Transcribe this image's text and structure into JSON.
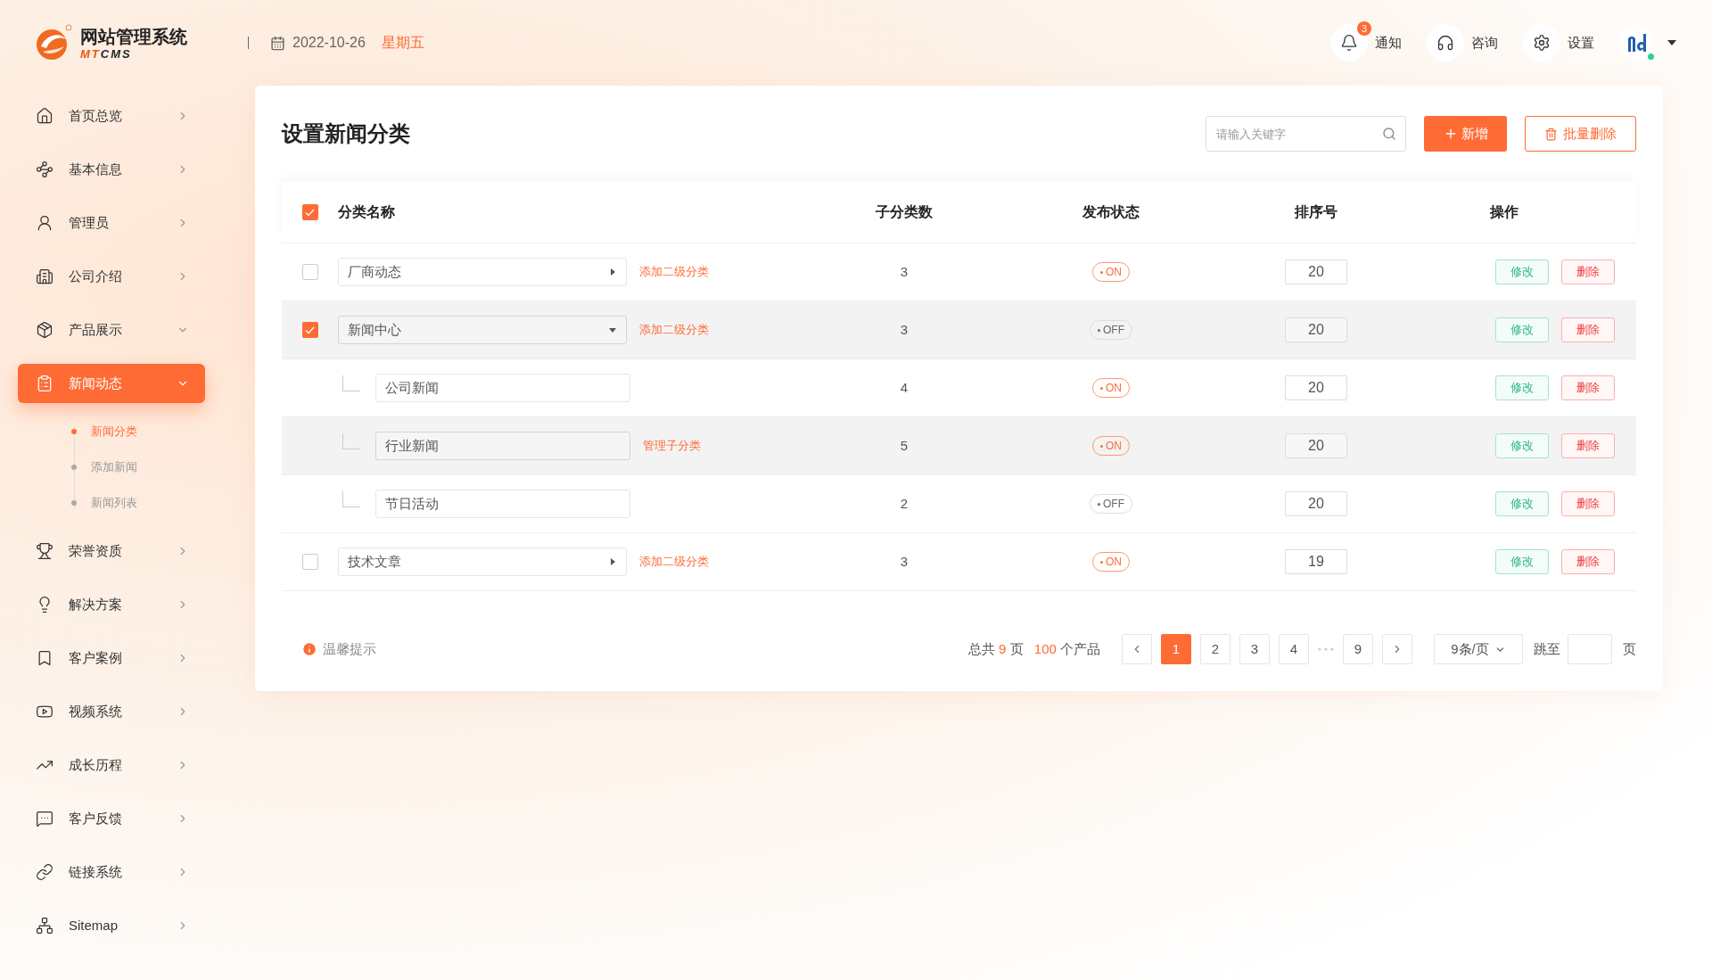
{
  "logo": {
    "title": "网站管理系统",
    "subtitle_parts": [
      "MT",
      "CMS"
    ]
  },
  "header": {
    "date": "2022-10-26",
    "weekday": "星期五",
    "notify": {
      "label": "通知",
      "badge": "3"
    },
    "consult": {
      "label": "咨询"
    },
    "settings": {
      "label": "设置"
    },
    "avatar": {
      "online": true
    }
  },
  "sidebar": {
    "items": [
      {
        "label": "首页总览",
        "selected": false,
        "expanded": false
      },
      {
        "label": "基本信息",
        "selected": false,
        "expanded": false
      },
      {
        "label": "管理员",
        "selected": false,
        "expanded": false
      },
      {
        "label": "公司介绍",
        "selected": false,
        "expanded": false
      },
      {
        "label": "产品展示",
        "selected": false,
        "expanded": true
      },
      {
        "label": "新闻动态",
        "selected": true,
        "expanded": true,
        "children": [
          {
            "label": "新闻分类",
            "selected": true
          },
          {
            "label": "添加新闻",
            "selected": false
          },
          {
            "label": "新闻列表",
            "selected": false
          }
        ]
      },
      {
        "label": "荣誉资质",
        "selected": false,
        "expanded": false
      },
      {
        "label": "解决方案",
        "selected": false,
        "expanded": false
      },
      {
        "label": "客户案例",
        "selected": false,
        "expanded": false
      },
      {
        "label": "视频系统",
        "selected": false,
        "expanded": false
      },
      {
        "label": "成长历程",
        "selected": false,
        "expanded": false
      },
      {
        "label": "客户反馈",
        "selected": false,
        "expanded": false
      },
      {
        "label": "链接系统",
        "selected": false,
        "expanded": false
      },
      {
        "label": "Sitemap",
        "selected": false,
        "expanded": false
      }
    ]
  },
  "page": {
    "title": "设置新闻分类",
    "search": {
      "placeholder": "请输入关键字"
    },
    "add_button": "新增",
    "batch_delete_button": "批量删除"
  },
  "table": {
    "all_checked": true,
    "columns": [
      "分类名称",
      "子分类数",
      "发布状态",
      "排序号",
      "操作"
    ],
    "rows": [
      {
        "name": "厂商动态",
        "checked": false,
        "expanded": false,
        "highlighted": false,
        "link": "添加二级分类",
        "count": "3",
        "status": "ON",
        "on": true,
        "sort": "20",
        "actions": [
          {
            "label": "修改",
            "kind": "edit"
          },
          {
            "label": "删除",
            "kind": "delete"
          }
        ]
      },
      {
        "name": "新闻中心",
        "checked": true,
        "expanded": true,
        "highlighted": true,
        "link": "添加二级分类",
        "count": "3",
        "status": "OFF",
        "on": false,
        "sort": "20",
        "actions": [
          {
            "label": "修改",
            "kind": "edit"
          },
          {
            "label": "删除",
            "kind": "delete"
          }
        ],
        "children": [
          {
            "name": "公司新闻",
            "highlighted": false,
            "count": "4",
            "status": "ON",
            "on": true,
            "sort": "20",
            "actions": [
              {
                "label": "修改",
                "kind": "edit"
              },
              {
                "label": "删除",
                "kind": "delete"
              }
            ]
          },
          {
            "name": "行业新闻",
            "highlighted": true,
            "link": "管理子分类",
            "count": "5",
            "status": "ON",
            "on": true,
            "sort": "20",
            "actions": [
              {
                "label": "修改",
                "kind": "edit"
              },
              {
                "label": "删除",
                "kind": "delete"
              }
            ]
          },
          {
            "name": "节日活动",
            "highlighted": false,
            "count": "2",
            "status": "OFF",
            "on": false,
            "sort": "20",
            "actions": [
              {
                "label": "修改",
                "kind": "edit"
              },
              {
                "label": "删除",
                "kind": "delete"
              }
            ]
          }
        ]
      },
      {
        "name": "技术文章",
        "checked": false,
        "expanded": false,
        "highlighted": false,
        "link": "添加二级分类",
        "count": "3",
        "status": "ON",
        "on": true,
        "sort": "19",
        "actions": [
          {
            "label": "修改",
            "kind": "edit"
          },
          {
            "label": "删除",
            "kind": "delete"
          }
        ]
      }
    ]
  },
  "footer": {
    "tip": "温馨提示",
    "summary": {
      "prefix": "总共",
      "pages": "9",
      "pages_unit": "页",
      "count": "100",
      "count_unit": "个产品"
    },
    "pages": [
      {
        "label": "1",
        "selected": true
      },
      {
        "label": "2",
        "selected": false
      },
      {
        "label": "3",
        "selected": false
      },
      {
        "label": "4",
        "selected": false
      },
      {
        "kind": "ellipsis"
      },
      {
        "label": "9",
        "selected": false
      }
    ],
    "page_size": "9条/页",
    "jump_label": "跳至",
    "jump_unit": "页"
  }
}
